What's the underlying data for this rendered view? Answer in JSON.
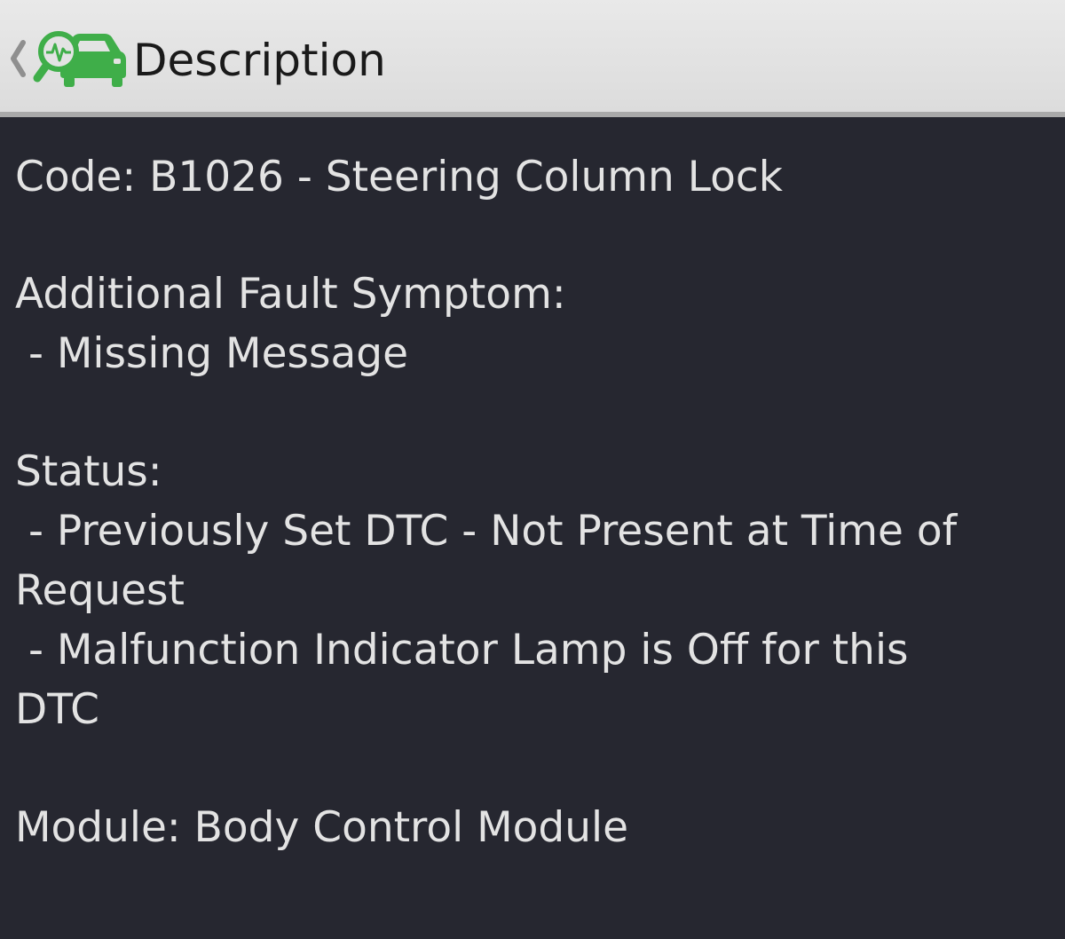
{
  "header": {
    "title": "Description",
    "back_icon": "chevron-left-icon",
    "logo_icon": "car-diagnostic-icon",
    "logo_color": "#3fae49"
  },
  "description": {
    "code_line": "Code: B1026 - Steering Column Lock",
    "symptom_heading": "Additional Fault Symptom:",
    "symptom_items": [
      " - Missing Message"
    ],
    "status_heading": "Status:",
    "status_lines": [
      " - Previously Set DTC - Not Present at Time of",
      "Request",
      " - Malfunction Indicator Lamp is Off for this",
      "DTC"
    ],
    "module_line": "Module: Body Control Module"
  },
  "colors": {
    "background": "#262730",
    "header_bg": "#e3e3e3",
    "text": "#e3e3e3",
    "accent": "#3fae49"
  }
}
